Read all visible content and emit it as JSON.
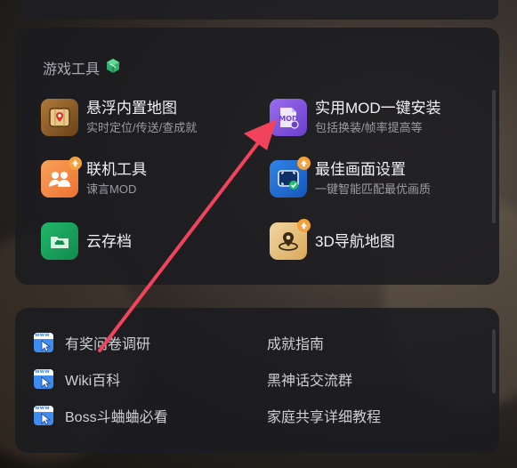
{
  "tools_section": {
    "title": "游戏工具",
    "items": [
      {
        "name": "悬浮内置地图",
        "desc": "实时定位/传送/查成就",
        "icon": "map-icon"
      },
      {
        "name": "实用MOD一键安装",
        "desc": "包括换装/帧率提高等",
        "icon": "mod-icon"
      },
      {
        "name": "联机工具",
        "desc": "谏言MOD",
        "icon": "multiplayer-icon"
      },
      {
        "name": "最佳画面设置",
        "desc": "一键智能匹配最优画质",
        "icon": "display-settings-icon"
      },
      {
        "name": "云存档",
        "desc": "",
        "icon": "cloud-save-icon"
      },
      {
        "name": "3D导航地图",
        "desc": "",
        "icon": "3d-map-icon"
      }
    ]
  },
  "links_section": {
    "items": [
      {
        "label": "有奖问卷调研",
        "icon": "www-icon"
      },
      {
        "label": "成就指南"
      },
      {
        "label": "Wiki百科",
        "icon": "www-icon"
      },
      {
        "label": "黑神话交流群"
      },
      {
        "label": "Boss斗蛐蛐必看",
        "icon": "www-icon"
      },
      {
        "label": "家庭共享详细教程"
      }
    ]
  },
  "colors": {
    "arrow": "#f2435d",
    "mod_icon": "#7a4fd6",
    "map_icon": "#8a5a28",
    "multiplayer_icon": "#f0843a",
    "display_icon": "#1f6fd8",
    "cloud_icon": "#1aa05a",
    "link_icon": "#3f8cf0",
    "badge": "#f4a13b"
  }
}
